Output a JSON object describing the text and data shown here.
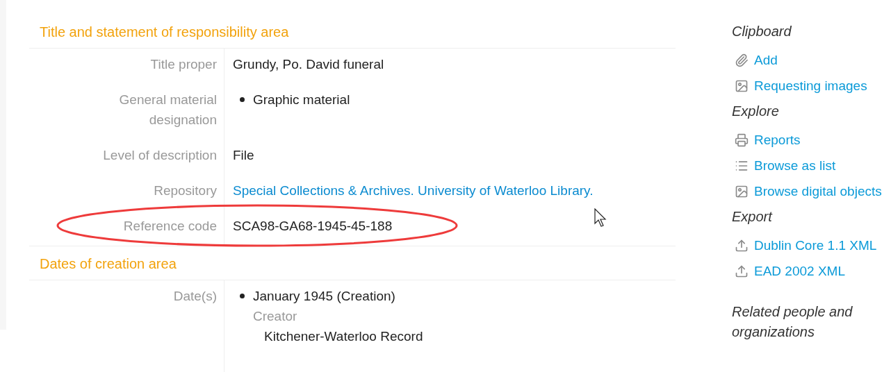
{
  "sections": [
    {
      "heading": "Title and statement of responsibility area",
      "fields": [
        {
          "kind": "text",
          "label": "Title proper",
          "value": "Grundy, Po. David funeral"
        },
        {
          "kind": "list",
          "label": "General material designation",
          "items": [
            "Graphic material"
          ]
        },
        {
          "kind": "text",
          "label": "Level of description",
          "value": "File"
        },
        {
          "kind": "link",
          "label": "Repository",
          "value": "Special Collections & Archives. University of Waterloo Library."
        },
        {
          "kind": "text",
          "label": "Reference code",
          "value": "SCA98-GA68-1945-45-188"
        }
      ]
    },
    {
      "heading": "Dates of creation area",
      "fields": [
        {
          "kind": "event",
          "label": "Date(s)",
          "date": "January 1945 (Creation)",
          "role": "Creator",
          "agent": "Kitchener-Waterloo Record"
        }
      ]
    }
  ],
  "sidebar": [
    {
      "heading": "Clipboard",
      "items": [
        {
          "kind": "clip",
          "label": "Add"
        },
        {
          "kind": "image",
          "label": "Requesting images"
        }
      ]
    },
    {
      "heading": "Explore",
      "items": [
        {
          "kind": "print",
          "label": "Reports"
        },
        {
          "kind": "list",
          "label": "Browse as list"
        },
        {
          "kind": "image",
          "label": "Browse digital objects"
        }
      ]
    },
    {
      "heading": "Export",
      "items": [
        {
          "kind": "export",
          "label": "Dublin Core 1.1 XML"
        },
        {
          "kind": "export",
          "label": "EAD 2002 XML"
        }
      ]
    },
    {
      "heading": "Related people and organizations"
    }
  ]
}
